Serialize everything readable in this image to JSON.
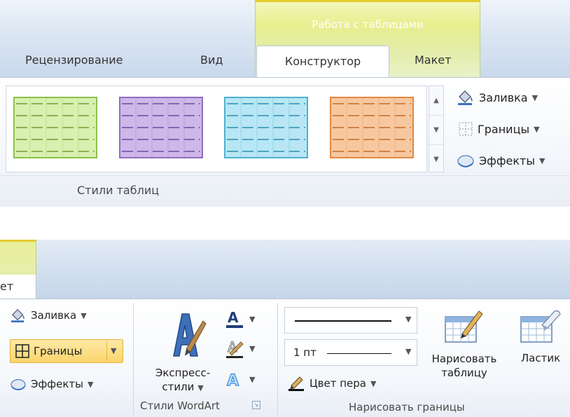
{
  "top": {
    "context_title": "Работа с таблицами",
    "tabs": {
      "review": "Рецензирование",
      "view": "Вид",
      "designer": "Конструктор",
      "layout": "Макет"
    },
    "group_label": "Стили таблиц",
    "commands": {
      "fill": "Заливка",
      "borders": "Границы",
      "effects": "Эффекты"
    },
    "swatch_colors": {
      "green": "#d8f0b0",
      "purple": "#cdb8e8",
      "cyan": "#b8e6f4",
      "orange": "#f7c8a0"
    }
  },
  "bottom": {
    "tab_fragment": "ет",
    "commands": {
      "fill": "Заливка",
      "borders": "Границы",
      "effects": "Эффекты",
      "express_styles_line1": "Экспресс-",
      "express_styles_line2": "стили",
      "pen_color": "Цвет пера",
      "draw_table_line1": "Нарисовать",
      "draw_table_line2": "таблицу",
      "eraser": "Ластик"
    },
    "line_weight": "1 пт",
    "group_labels": {
      "wordart": "Стили WordArt",
      "draw_borders": "Нарисовать границы"
    }
  }
}
